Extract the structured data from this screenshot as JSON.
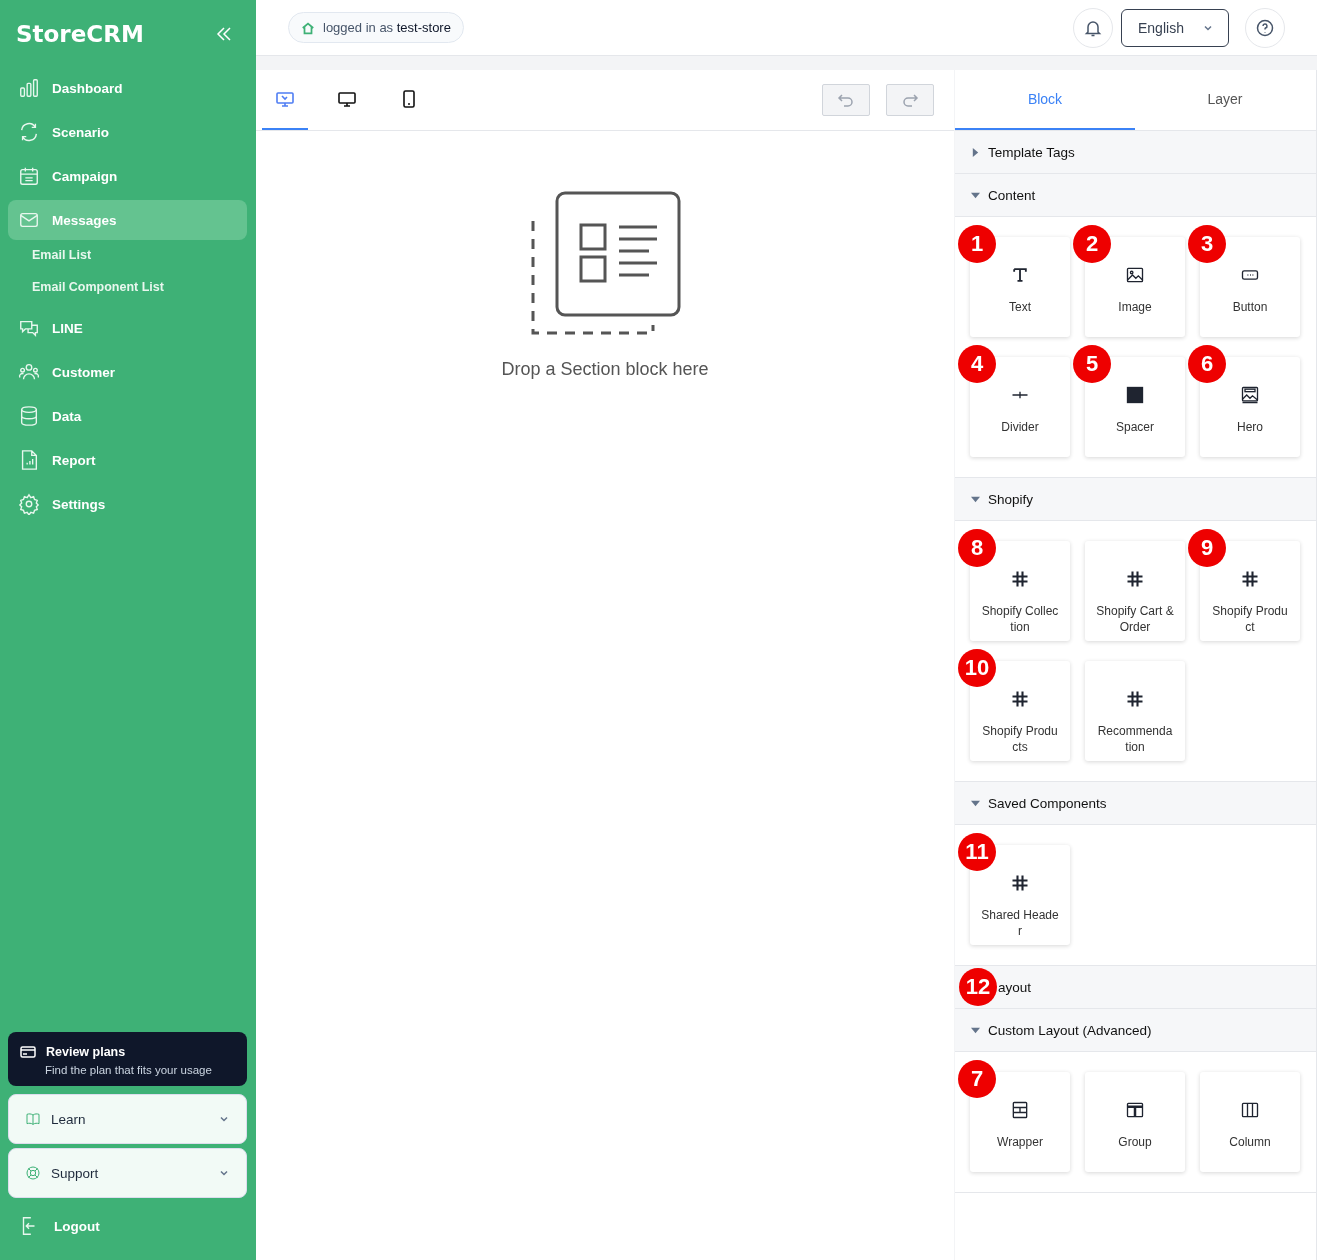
{
  "sidebar": {
    "logo": "StoreCRM",
    "items": [
      {
        "label": "Dashboard",
        "selected": false
      },
      {
        "label": "Scenario",
        "selected": false
      },
      {
        "label": "Campaign",
        "selected": false
      },
      {
        "label": "Messages",
        "selected": true,
        "children": [
          {
            "label": "Email List"
          },
          {
            "label": "Email Component List"
          }
        ]
      },
      {
        "label": "LINE",
        "selected": false
      },
      {
        "label": "Customer",
        "selected": false
      },
      {
        "label": "Data",
        "selected": false
      },
      {
        "label": "Report",
        "selected": false
      },
      {
        "label": "Settings",
        "selected": false
      }
    ],
    "promo": {
      "title": "Review plans",
      "subtitle": "Find the plan that fits your usage"
    },
    "accordions": [
      {
        "label": "Learn",
        "expanded": false
      },
      {
        "label": "Support",
        "expanded": false
      }
    ],
    "logout": "Logout"
  },
  "topbar": {
    "login_prefix": "logged in as",
    "store": "test-store",
    "language": "English"
  },
  "editor": {
    "devices": [
      {
        "kind": "custom",
        "selected": true
      },
      {
        "kind": "desktop",
        "selected": false
      },
      {
        "kind": "mobile",
        "selected": false
      }
    ],
    "undo_disabled": true,
    "redo_disabled": true,
    "drop_hint": "Drop a Section block here"
  },
  "panel": {
    "tabs": [
      {
        "label": "Block",
        "selected": true
      },
      {
        "label": "Layer",
        "selected": false
      }
    ],
    "sections": [
      {
        "title": "Template Tags",
        "expanded": false
      },
      {
        "title": "Content",
        "expanded": true,
        "blocks": [
          {
            "label": "Text",
            "kind": "text",
            "marker": "1"
          },
          {
            "label": "Image",
            "kind": "image",
            "marker": "2"
          },
          {
            "label": "Button",
            "kind": "button",
            "marker": "3"
          },
          {
            "label": "Divider",
            "kind": "divider",
            "marker": "4"
          },
          {
            "label": "Spacer",
            "kind": "spacer",
            "marker": "5"
          },
          {
            "label": "Hero",
            "kind": "hero",
            "marker": "6"
          }
        ]
      },
      {
        "title": "Shopify",
        "expanded": true,
        "blocks": [
          {
            "label": "Shopify Collection",
            "kind": "shopify",
            "marker": "8"
          },
          {
            "label": "Shopify Cart & Order",
            "kind": "shopify"
          },
          {
            "label": "Shopify Product",
            "kind": "shopify",
            "marker": "9"
          },
          {
            "label": "Shopify Products",
            "kind": "shopify",
            "marker": "10"
          },
          {
            "label": "Recommendation",
            "kind": "shopify"
          }
        ]
      },
      {
        "title": "Saved Components",
        "expanded": true,
        "blocks": [
          {
            "label": "Shared Header",
            "kind": "shopify",
            "marker": "11"
          }
        ]
      },
      {
        "title": "ayout",
        "marker": "12"
      },
      {
        "title": "Custom Layout (Advanced)",
        "expanded": true,
        "blocks": [
          {
            "label": "Wrapper",
            "kind": "wrapper",
            "marker": "7"
          },
          {
            "label": "Group",
            "kind": "group"
          },
          {
            "label": "Column",
            "kind": "column"
          }
        ]
      }
    ]
  }
}
